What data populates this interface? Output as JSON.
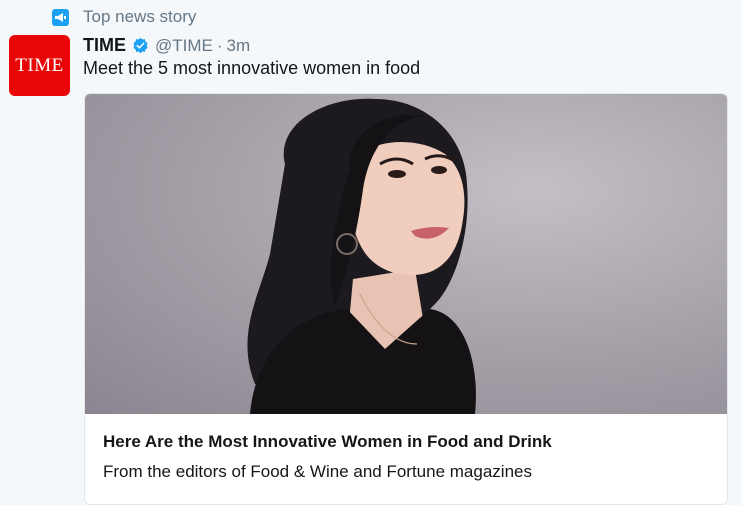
{
  "context": {
    "label": "Top news story",
    "icon": "megaphone-icon"
  },
  "tweet": {
    "avatar_text": "TIME",
    "author_name": "TIME",
    "verified": true,
    "handle": "@TIME",
    "separator": "·",
    "timestamp": "3m",
    "text": "Meet the 5 most innovative women in food"
  },
  "card": {
    "image_subject": "portrait of a smiling woman with dark hair",
    "title": "Here Are the Most Innovative Women in Food and Drink",
    "description": "From the editors of Food & Wine and Fortune magazines"
  },
  "colors": {
    "background": "#f5f8fa",
    "accent": "#1da1f2",
    "avatar_red": "#e90606",
    "secondary_text": "#657786"
  }
}
